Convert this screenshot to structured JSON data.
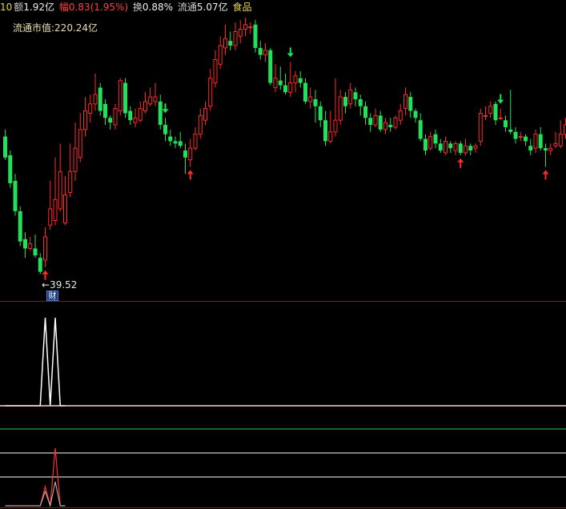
{
  "header": {
    "code_fragment": "10",
    "amount_label": "额",
    "amount_value": "1.92亿",
    "amplitude_label": "幅",
    "amplitude_value": "0.83(1.95%)",
    "turnover_label": "换",
    "turnover_value": "0.88%",
    "float_label": "流通",
    "float_value": "5.07亿",
    "sector": "食品"
  },
  "market_cap": "流通市值:220.24亿",
  "low_marker": {
    "arrow": "←",
    "value": "39.52"
  },
  "finance_badge": "财",
  "colors": {
    "up": "#ff2a2a",
    "down": "#22e05a",
    "header_value": "#f0f0f0",
    "header_amp": "#ff4040",
    "header_sector": "#e8d44a",
    "separator": "#7a1e1e",
    "sub_line_white": "#ffffff",
    "sub_line_green": "#3fbf3f",
    "sub_line_red": "#ff3030"
  },
  "chart_data": {
    "type": "candlestick",
    "price_axis": {
      "min": 38.6,
      "max": 50.2
    },
    "candles": [
      [
        45.1,
        44.2,
        45.4,
        44.1
      ],
      [
        44.3,
        43.1,
        44.5,
        42.9
      ],
      [
        43.2,
        41.9,
        43.5,
        41.7
      ],
      [
        41.9,
        40.6,
        42.1,
        40.4
      ],
      [
        40.7,
        40.3,
        41.0,
        39.9
      ],
      [
        40.3,
        40.5,
        40.8,
        40.2
      ],
      [
        40.3,
        40.0,
        40.9,
        39.9
      ],
      [
        39.9,
        39.3,
        40.1,
        39.2
      ],
      [
        39.8,
        40.8,
        41.2,
        39.5
      ],
      [
        41.3,
        42.0,
        43.2,
        41.1
      ],
      [
        41.5,
        42.4,
        44.2,
        41.3
      ],
      [
        42.0,
        43.6,
        44.8,
        41.9
      ],
      [
        41.4,
        42.6,
        43.4,
        41.3
      ],
      [
        42.7,
        43.6,
        44.8,
        42.5
      ],
      [
        43.6,
        44.6,
        45.7,
        43.2
      ],
      [
        44.2,
        45.4,
        46.1,
        44.0
      ],
      [
        45.4,
        46.2,
        46.8,
        45.1
      ],
      [
        46.1,
        46.5,
        46.9,
        45.7
      ],
      [
        46.5,
        46.9,
        47.8,
        46.2
      ],
      [
        47.2,
        46.2,
        47.4,
        46.0
      ],
      [
        46.5,
        45.9,
        46.7,
        45.6
      ],
      [
        45.9,
        45.7,
        46.0,
        45.4
      ],
      [
        45.6,
        46.3,
        46.5,
        45.4
      ],
      [
        46.2,
        47.5,
        47.6,
        46.0
      ],
      [
        47.4,
        46.1,
        47.6,
        45.9
      ],
      [
        46.2,
        45.8,
        46.4,
        45.6
      ],
      [
        45.7,
        45.9,
        46.3,
        45.5
      ],
      [
        45.8,
        46.3,
        46.6,
        45.7
      ],
      [
        46.2,
        46.6,
        47.0,
        46.1
      ],
      [
        46.5,
        46.8,
        47.2,
        46.4
      ],
      [
        46.6,
        46.8,
        47.4,
        46.4
      ],
      [
        46.6,
        45.6,
        46.9,
        45.4
      ],
      [
        45.6,
        45.2,
        45.9,
        44.9
      ],
      [
        45.1,
        44.9,
        45.4,
        44.7
      ],
      [
        44.9,
        44.8,
        45.1,
        44.6
      ],
      [
        44.9,
        44.7,
        45.3,
        44.6
      ],
      [
        44.5,
        44.2,
        44.8,
        43.5
      ],
      [
        44.1,
        44.6,
        45.0,
        43.8
      ],
      [
        44.6,
        45.2,
        45.5,
        44.5
      ],
      [
        45.2,
        46.0,
        46.3,
        45.0
      ],
      [
        45.8,
        46.3,
        46.6,
        45.6
      ],
      [
        46.4,
        47.6,
        48.0,
        46.2
      ],
      [
        47.4,
        48.4,
        48.8,
        47.2
      ],
      [
        48.2,
        49.0,
        49.4,
        48.0
      ],
      [
        48.9,
        49.3,
        49.9,
        48.6
      ],
      [
        49.2,
        49.0,
        49.6,
        48.8
      ],
      [
        49.0,
        49.6,
        50.0,
        48.8
      ],
      [
        49.4,
        49.7,
        50.1,
        49.1
      ],
      [
        49.7,
        49.9,
        50.2,
        49.4
      ],
      [
        49.8,
        49.8,
        50.0,
        49.5
      ],
      [
        49.9,
        48.9,
        50.1,
        48.7
      ],
      [
        48.9,
        48.6,
        49.2,
        48.4
      ],
      [
        48.6,
        48.8,
        49.1,
        48.3
      ],
      [
        48.8,
        47.4,
        48.9,
        47.3
      ],
      [
        47.2,
        47.6,
        48.2,
        47.0
      ],
      [
        47.5,
        47.3,
        48.1,
        47.1
      ],
      [
        47.3,
        47.0,
        47.8,
        46.9
      ],
      [
        47.0,
        47.4,
        48.3,
        46.8
      ],
      [
        47.4,
        47.7,
        47.9,
        47.0
      ],
      [
        47.6,
        47.4,
        47.9,
        47.2
      ],
      [
        47.4,
        46.6,
        47.6,
        46.5
      ],
      [
        46.6,
        46.8,
        47.2,
        46.3
      ],
      [
        46.7,
        46.4,
        47.1,
        45.7
      ],
      [
        46.4,
        45.8,
        46.6,
        45.5
      ],
      [
        45.8,
        44.9,
        46.2,
        44.7
      ],
      [
        44.9,
        45.3,
        46.2,
        44.8
      ],
      [
        45.3,
        45.8,
        47.6,
        45.1
      ],
      [
        45.8,
        46.8,
        47.1,
        45.6
      ],
      [
        46.8,
        46.4,
        47.0,
        46.1
      ],
      [
        46.5,
        47.1,
        47.4,
        46.3
      ],
      [
        47.0,
        46.7,
        47.2,
        46.4
      ],
      [
        46.7,
        46.4,
        46.9,
        46.0
      ],
      [
        46.4,
        45.9,
        46.6,
        45.6
      ],
      [
        45.9,
        45.6,
        46.1,
        45.3
      ],
      [
        45.6,
        46.0,
        46.3,
        45.5
      ],
      [
        46.0,
        45.4,
        46.2,
        45.3
      ],
      [
        45.4,
        45.7,
        45.9,
        45.2
      ],
      [
        45.6,
        45.5,
        45.9,
        45.3
      ],
      [
        45.5,
        45.9,
        46.0,
        45.4
      ],
      [
        45.8,
        46.2,
        46.5,
        45.6
      ],
      [
        46.3,
        46.9,
        47.2,
        46.0
      ],
      [
        46.8,
        46.2,
        47.0,
        45.9
      ],
      [
        46.2,
        45.9,
        46.3,
        45.7
      ],
      [
        45.8,
        45.0,
        46.1,
        44.9
      ],
      [
        45.0,
        44.5,
        45.2,
        44.3
      ],
      [
        44.6,
        45.1,
        45.3,
        44.5
      ],
      [
        45.2,
        44.8,
        45.4,
        44.6
      ],
      [
        44.8,
        44.5,
        45.0,
        44.4
      ],
      [
        44.4,
        44.9,
        45.1,
        44.3
      ],
      [
        44.8,
        44.6,
        44.9,
        44.4
      ],
      [
        44.5,
        44.8,
        44.9,
        44.3
      ],
      [
        44.8,
        44.4,
        44.9,
        44.3
      ],
      [
        44.4,
        44.7,
        45.0,
        44.3
      ],
      [
        44.7,
        44.5,
        44.8,
        44.3
      ],
      [
        44.6,
        44.7,
        44.8,
        44.4
      ],
      [
        44.9,
        46.1,
        46.3,
        44.7
      ],
      [
        46.0,
        46.0,
        46.4,
        45.8
      ],
      [
        46.1,
        46.4,
        46.6,
        45.9
      ],
      [
        46.5,
        45.8,
        46.6,
        45.6
      ],
      [
        45.9,
        45.9,
        46.3,
        45.8
      ],
      [
        45.8,
        45.5,
        46.0,
        45.3
      ],
      [
        45.4,
        45.3,
        47.1,
        45.2
      ],
      [
        45.3,
        45.0,
        45.5,
        44.8
      ],
      [
        45.1,
        45.1,
        45.3,
        44.9
      ],
      [
        45.1,
        44.9,
        45.2,
        44.7
      ],
      [
        44.7,
        44.5,
        45.0,
        44.3
      ],
      [
        44.6,
        45.2,
        45.4,
        44.4
      ],
      [
        45.2,
        44.6,
        45.5,
        44.5
      ],
      [
        44.6,
        44.5,
        44.8,
        43.8
      ],
      [
        44.5,
        44.6,
        44.8,
        44.3
      ],
      [
        44.7,
        44.8,
        45.3,
        44.6
      ],
      [
        44.7,
        45.2,
        45.8,
        44.6
      ],
      [
        45.2,
        45.6,
        45.9,
        45.0
      ]
    ],
    "sell_arrows": [
      32,
      57,
      99
    ],
    "buy_arrows": [
      8,
      37,
      91,
      108
    ],
    "low_index": 6,
    "sub_upper": {
      "y_range": [
        0,
        100
      ],
      "series_white": [
        0,
        0,
        0,
        0,
        0,
        0,
        0,
        0,
        100,
        0,
        100,
        0,
        0
      ],
      "baseline": 0
    },
    "sub_lower": {
      "y_range": [
        0,
        100
      ],
      "levels": [
        80,
        55,
        30
      ],
      "series_red": [
        0,
        0,
        0,
        0,
        0,
        0,
        0,
        0,
        20,
        0,
        60,
        0,
        0
      ],
      "series_white": [
        0,
        0,
        0,
        0,
        0,
        0,
        0,
        0,
        15,
        0,
        25,
        0,
        0
      ]
    }
  }
}
